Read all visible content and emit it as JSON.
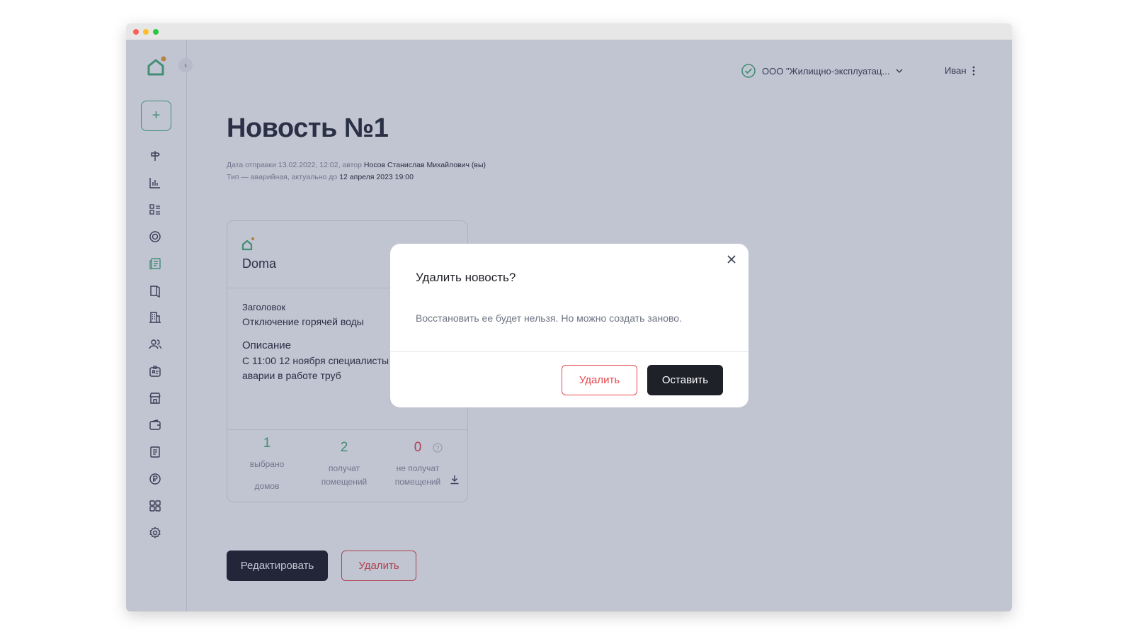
{
  "header": {
    "org_name": "ООО \"Жилищно-эксплуатац...",
    "user_name": "Иван"
  },
  "sidebar": {
    "add_label": "+",
    "items": [
      {
        "icon": "signpost-icon"
      },
      {
        "icon": "bar-chart-icon"
      },
      {
        "icon": "list-icon"
      },
      {
        "icon": "target-icon"
      },
      {
        "icon": "news-icon",
        "active": true
      },
      {
        "icon": "book-icon"
      },
      {
        "icon": "building-icon"
      },
      {
        "icon": "users-icon"
      },
      {
        "icon": "id-badge-icon"
      },
      {
        "icon": "store-icon"
      },
      {
        "icon": "wallet-icon"
      },
      {
        "icon": "document-icon"
      },
      {
        "icon": "ruble-icon"
      },
      {
        "icon": "grid-icon"
      },
      {
        "icon": "settings-icon"
      }
    ]
  },
  "page": {
    "title": "Новость №1",
    "meta_line1_prefix": "Дата отправки 13.02.2022, 12:02, автор ",
    "meta_line1_author": "Носов Станислав Михайлович (вы)",
    "meta_line2_prefix": "Тип — аварийная, актуально до ",
    "meta_line2_date": "12 апреля 2023 19:00"
  },
  "card": {
    "brand": "Doma",
    "title_label": "Заголовок",
    "title_value": "Отключение горячей воды",
    "desc_label": "Описание",
    "desc_line1": "С 11:00 12 ноября специалисты",
    "desc_line2": "аварии в работе труб",
    "stats": [
      {
        "value": "1",
        "label_line1": "выбрано",
        "label_line2": "домов"
      },
      {
        "value": "2",
        "label_line1": "получат",
        "label_line2": "помещений"
      },
      {
        "value": "0",
        "label_line1": "не получат",
        "label_line2": "помещений"
      }
    ]
  },
  "actions": {
    "edit_label": "Редактировать",
    "delete_label": "Удалить"
  },
  "modal": {
    "title": "Удалить новость?",
    "text": "Восстановить ее будет нельзя. Но можно создать заново.",
    "delete_label": "Удалить",
    "keep_label": "Оставить"
  },
  "colors": {
    "accent_green": "#4fb37e",
    "danger_red": "#e5484d",
    "dark": "#1f2128",
    "logo_dot": "#f0a53c"
  }
}
